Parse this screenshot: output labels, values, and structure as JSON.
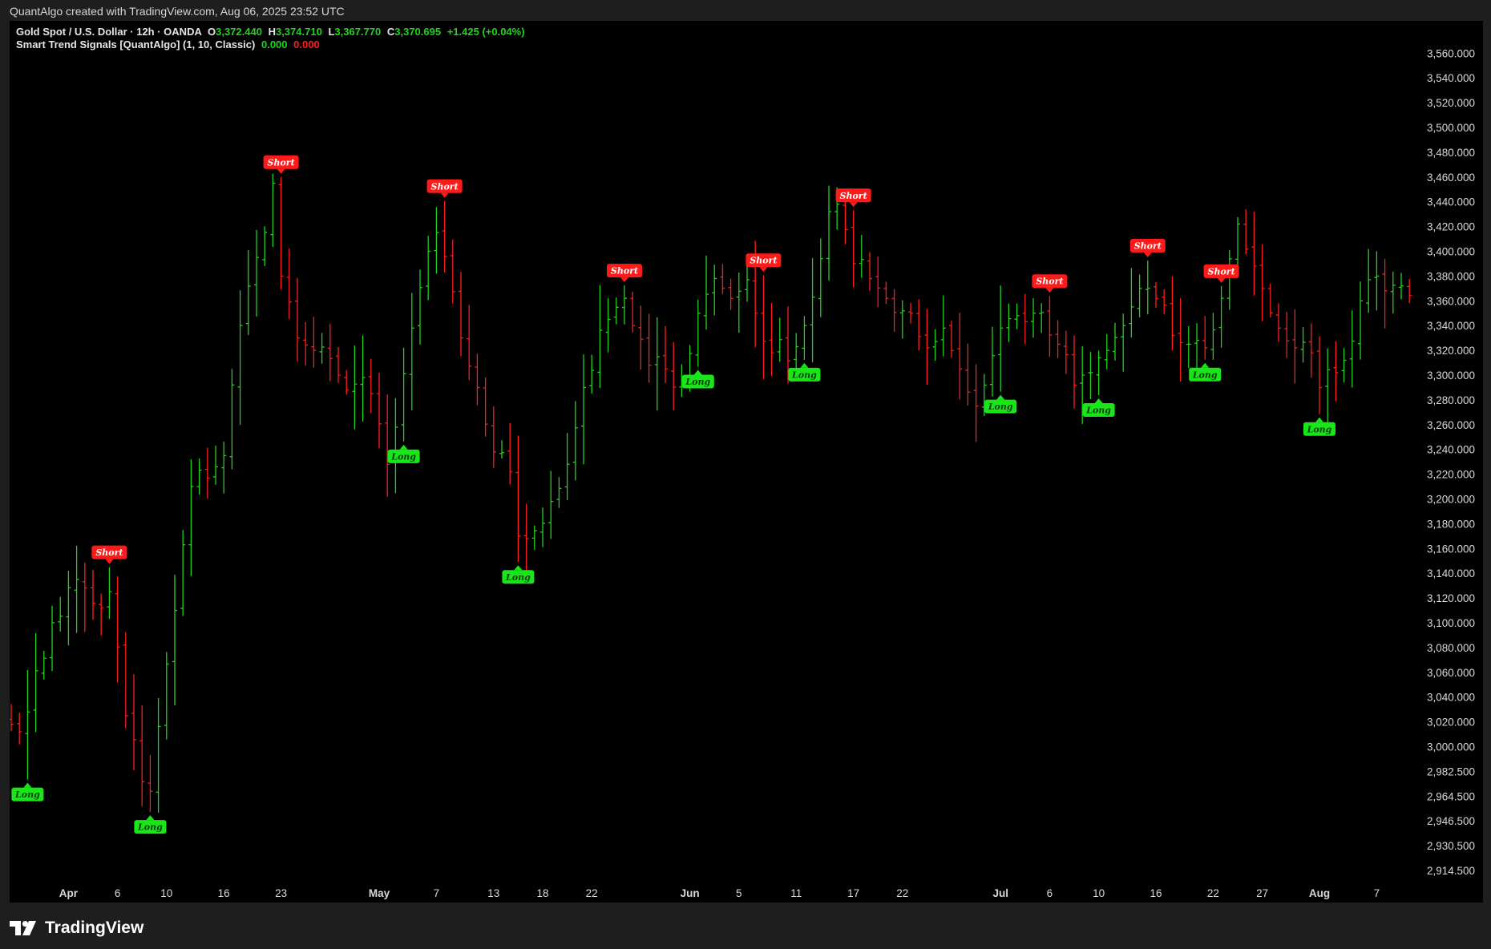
{
  "header": {
    "attribution": "QuantAlgo created with TradingView.com, Aug 06, 2025 23:52 UTC"
  },
  "legend": {
    "symbol": "Gold Spot / U.S. Dollar · 12h · OANDA",
    "o_label": "O",
    "o_value": "3,372.440",
    "h_label": "H",
    "h_value": "3,374.710",
    "l_label": "L",
    "l_value": "3,367.770",
    "c_label": "C",
    "c_value": "3,370.695",
    "change": "+1.425 (+0.04%)",
    "indicator": "Smart Trend Signals [QuantAlgo] (1, 10, Classic)",
    "ind_val_1": "0.000",
    "ind_val_2": "0.000"
  },
  "footer": {
    "brand": "TradingView"
  },
  "colors": {
    "up": "#22d31e",
    "down": "#ff1c1c",
    "long_badge": "#19e619",
    "short_badge": "#ff1a1a",
    "background": "#000000"
  },
  "chart_data": {
    "type": "ohlc-bars",
    "y_ticks": [
      2914.5,
      2930.5,
      2946.5,
      2964.5,
      2982.5,
      3000,
      3020,
      3040,
      3060,
      3080,
      3100,
      3120,
      3140,
      3160,
      3180,
      3200,
      3220,
      3240,
      3260,
      3280,
      3300,
      3320,
      3340,
      3360,
      3380,
      3400,
      3420,
      3440,
      3460,
      3480,
      3500,
      3520,
      3540,
      3560
    ],
    "y_tick_labels": [
      "2,914.500",
      "2,930.500",
      "2,946.500",
      "2,964.500",
      "2,982.500",
      "3,000.000",
      "3,020.000",
      "3,040.000",
      "3,060.000",
      "3,080.000",
      "3,100.000",
      "3,120.000",
      "3,140.000",
      "3,160.000",
      "3,180.000",
      "3,200.000",
      "3,220.000",
      "3,240.000",
      "3,260.000",
      "3,280.000",
      "3,300.000",
      "3,320.000",
      "3,340.000",
      "3,360.000",
      "3,380.000",
      "3,400.000",
      "3,420.000",
      "3,440.000",
      "3,460.000",
      "3,480.000",
      "3,500.000",
      "3,520.000",
      "3,540.000",
      "3,560.000"
    ],
    "x_ticks": [
      {
        "label": "Apr",
        "i": 7,
        "bold": true
      },
      {
        "label": "6",
        "i": 13
      },
      {
        "label": "10",
        "i": 19
      },
      {
        "label": "16",
        "i": 26
      },
      {
        "label": "23",
        "i": 33
      },
      {
        "label": "May",
        "i": 45,
        "bold": true
      },
      {
        "label": "7",
        "i": 52
      },
      {
        "label": "13",
        "i": 59
      },
      {
        "label": "18",
        "i": 65
      },
      {
        "label": "22",
        "i": 71
      },
      {
        "label": "Jun",
        "i": 83,
        "bold": true
      },
      {
        "label": "5",
        "i": 89
      },
      {
        "label": "11",
        "i": 96
      },
      {
        "label": "17",
        "i": 103
      },
      {
        "label": "22",
        "i": 109
      },
      {
        "label": "Jul",
        "i": 121,
        "bold": true
      },
      {
        "label": "6",
        "i": 127
      },
      {
        "label": "10",
        "i": 133
      },
      {
        "label": "16",
        "i": 140
      },
      {
        "label": "22",
        "i": 147
      },
      {
        "label": "27",
        "i": 153
      },
      {
        "label": "Aug",
        "i": 160,
        "bold": true
      },
      {
        "label": "7",
        "i": 167
      }
    ],
    "anchors": [
      [
        0,
        3018
      ],
      [
        2,
        3028
      ],
      [
        5,
        3100
      ],
      [
        8,
        3135
      ],
      [
        11,
        3112
      ],
      [
        12,
        3125
      ],
      [
        14,
        3025
      ],
      [
        16,
        2975
      ],
      [
        17,
        2968
      ],
      [
        20,
        3110
      ],
      [
        22,
        3210
      ],
      [
        26,
        3235
      ],
      [
        28,
        3340
      ],
      [
        30,
        3395
      ],
      [
        32,
        3455
      ],
      [
        33,
        3380
      ],
      [
        35,
        3330
      ],
      [
        37,
        3320
      ],
      [
        40,
        3300
      ],
      [
        44,
        3285
      ],
      [
        46,
        3228
      ],
      [
        47,
        3258
      ],
      [
        49,
        3338
      ],
      [
        51,
        3400
      ],
      [
        52,
        3415
      ],
      [
        55,
        3330
      ],
      [
        57,
        3290
      ],
      [
        59,
        3238
      ],
      [
        61,
        3222
      ],
      [
        62,
        3170
      ],
      [
        63,
        3168
      ],
      [
        66,
        3198
      ],
      [
        68,
        3228
      ],
      [
        70,
        3290
      ],
      [
        73,
        3345
      ],
      [
        75,
        3362
      ],
      [
        76,
        3340
      ],
      [
        78,
        3308
      ],
      [
        80,
        3305
      ],
      [
        82,
        3295
      ],
      [
        84,
        3350
      ],
      [
        86,
        3378
      ],
      [
        88,
        3362
      ],
      [
        90,
        3377
      ],
      [
        91,
        3350
      ],
      [
        93,
        3318
      ],
      [
        96,
        3323
      ],
      [
        98,
        3363
      ],
      [
        100,
        3432
      ],
      [
        101,
        3438
      ],
      [
        103,
        3390
      ],
      [
        105,
        3378
      ],
      [
        107,
        3362
      ],
      [
        110,
        3350
      ],
      [
        112,
        3322
      ],
      [
        114,
        3338
      ],
      [
        116,
        3305
      ],
      [
        118,
        3275
      ],
      [
        119,
        3292
      ],
      [
        121,
        3338
      ],
      [
        123,
        3348
      ],
      [
        125,
        3350
      ],
      [
        128,
        3325
      ],
      [
        130,
        3292
      ],
      [
        132,
        3302
      ],
      [
        134,
        3320
      ],
      [
        136,
        3340
      ],
      [
        138,
        3370
      ],
      [
        140,
        3362
      ],
      [
        142,
        3332
      ],
      [
        144,
        3325
      ],
      [
        146,
        3322
      ],
      [
        148,
        3362
      ],
      [
        150,
        3422
      ],
      [
        152,
        3388
      ],
      [
        153,
        3370
      ],
      [
        155,
        3338
      ],
      [
        157,
        3322
      ],
      [
        159,
        3318
      ],
      [
        160,
        3290
      ],
      [
        162,
        3302
      ],
      [
        163,
        3312
      ],
      [
        165,
        3360
      ],
      [
        167,
        3380
      ],
      [
        170,
        3372
      ]
    ],
    "bar_count": 172,
    "signals": [
      {
        "type": "Long",
        "i": 2
      },
      {
        "type": "Short",
        "i": 12
      },
      {
        "type": "Long",
        "i": 17
      },
      {
        "type": "Short",
        "i": 33
      },
      {
        "type": "Long",
        "i": 48
      },
      {
        "type": "Short",
        "i": 53
      },
      {
        "type": "Long",
        "i": 62
      },
      {
        "type": "Short",
        "i": 75
      },
      {
        "type": "Long",
        "i": 84
      },
      {
        "type": "Short",
        "i": 92
      },
      {
        "type": "Long",
        "i": 97
      },
      {
        "type": "Short",
        "i": 103
      },
      {
        "type": "Long",
        "i": 121
      },
      {
        "type": "Short",
        "i": 127
      },
      {
        "type": "Long",
        "i": 133
      },
      {
        "type": "Short",
        "i": 139
      },
      {
        "type": "Long",
        "i": 146
      },
      {
        "type": "Short",
        "i": 148
      },
      {
        "type": "Long",
        "i": 160
      }
    ]
  }
}
